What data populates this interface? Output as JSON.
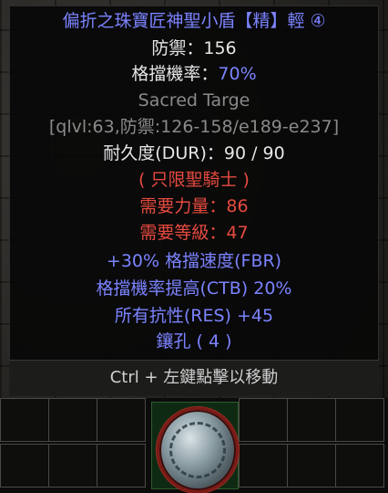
{
  "item": {
    "name": "偏折之珠寶匠神聖小盾【精】輕 ④",
    "defense_label": "防禦：156",
    "block_label": "格擋機率：",
    "block_value": "70%",
    "base_name": "Sacred Targe",
    "qlvl_line": "[qlvl:63,防禦:126-158/e189-e237]",
    "durability": "耐久度(DUR)：90 / 90",
    "class_req": "( 只限聖騎士 )",
    "str_req": "需要力量：86",
    "lvl_req": "需要等級：47",
    "mods": [
      "+30% 格擋速度(FBR)",
      "格擋機率提高(CTB) 20%",
      "所有抗性(RES) +45",
      "鑲孔 ( 4 )"
    ]
  },
  "hint": "Ctrl + 左鍵點擊以移動",
  "icons": {
    "item_icon": "sacred-targe-icon"
  },
  "colors": {
    "magic_blue": "#7b83ff",
    "requirement_red": "#e64a3f",
    "base_gray": "#8a8a8a",
    "text_white": "#e6e6e6"
  }
}
